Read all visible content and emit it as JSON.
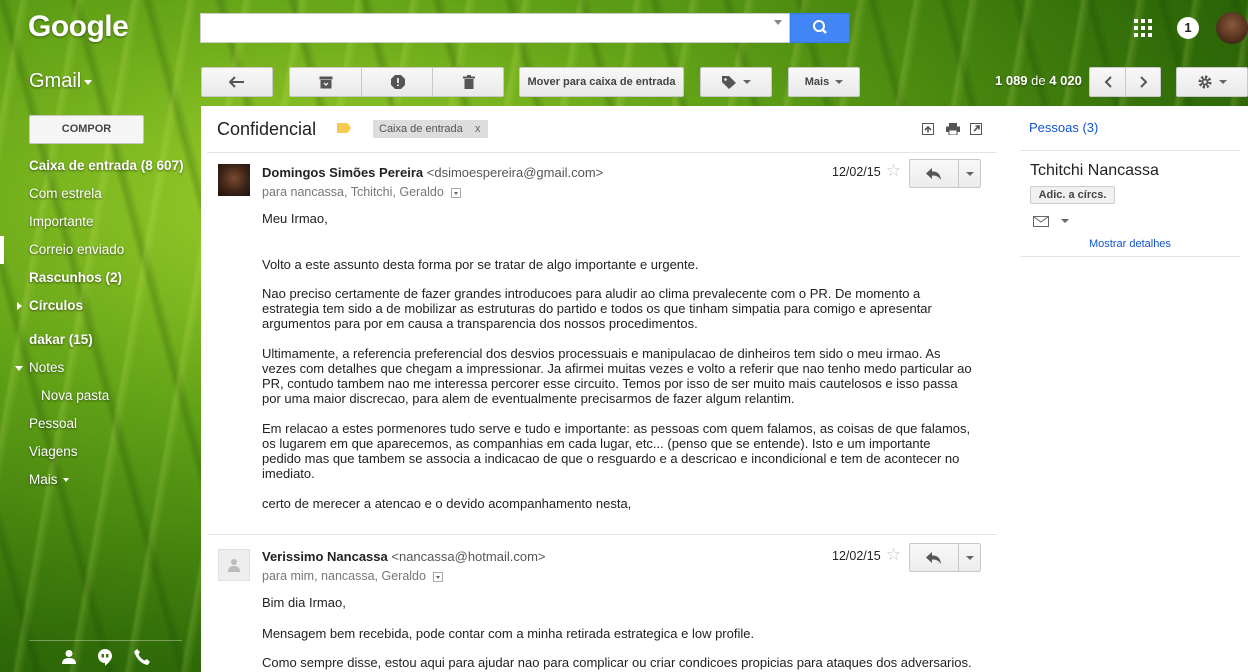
{
  "header": {
    "logo": "Google",
    "search_value": "",
    "notification_count": "1",
    "app_label": "Gmail"
  },
  "toolbar": {
    "move_to_inbox": "Mover para caixa de entrada",
    "more": "Mais",
    "range_start": "1 089",
    "range_of": "de",
    "range_total": "4 020"
  },
  "sidebar": {
    "compose": "COMPOR",
    "items": [
      {
        "label": "Caixa de entrada (8 607)",
        "bold": true
      },
      {
        "label": "Com estrela",
        "bold": false
      },
      {
        "label": "Importante",
        "bold": false
      },
      {
        "label": "Correio enviado",
        "bold": false
      },
      {
        "label": "Rascunhos (2)",
        "bold": true
      },
      {
        "label": "Círculos",
        "bold": true
      },
      {
        "label": "dakar (15)",
        "bold": true
      },
      {
        "label": "Notes",
        "bold": false
      },
      {
        "label": "Nova pasta",
        "bold": false
      },
      {
        "label": "Pessoal",
        "bold": false
      },
      {
        "label": "Viagens",
        "bold": false
      },
      {
        "label": "Mais",
        "bold": false
      }
    ]
  },
  "thread": {
    "subject": "Confidencial",
    "label_chip": "Caixa de entrada",
    "label_chip_remove": "x",
    "messages": [
      {
        "sender": "Domingos Simões Pereira",
        "email": "<dsimoespereira@gmail.com>",
        "recipients": "para nancassa, Tchitchi, Geraldo",
        "date": "12/02/15",
        "body": [
          "Meu Irmao,",
          "Volto a este assunto desta forma por se tratar de algo importante e urgente.",
          "Nao preciso certamente de fazer grandes introducoes para aludir ao clima prevalecente com o PR. De momento a estrategia tem sido a de mobilizar as estruturas do partido e todos os que tinham simpatia para comigo e apresentar argumentos para por em causa a transparencia dos nossos procedimentos.",
          "Ultimamente, a referencia preferencial dos desvios processuais e manipulacao de dinheiros tem sido o meu irmao. As vezes com detalhes que chegam a impressionar. Ja afirmei muitas vezes e volto a referir que nao tenho medo particular ao PR, contudo tambem nao me interessa percorer esse circuito. Temos por isso de ser muito mais cautelosos e isso passa por uma maior discrecao, para alem de eventualmente precisarmos de fazer algum relantim.",
          "Em relacao a estes pormenores tudo serve e tudo e importante: as pessoas com quem falamos, as coisas de que falamos, os lugarem em que aparecemos, as companhias em cada lugar, etc... (penso que se entende). Isto e um importante pedido mas que tambem se associa a indicacao de que o resguardo e a descricao e incondicional e tem de acontecer no imediato.",
          "certo de merecer a atencao e o devido acompanhamento nesta,"
        ]
      },
      {
        "sender": "Verissimo Nancassa",
        "email": "<nancassa@hotmail.com>",
        "recipients": "para mim, nancassa, Geraldo",
        "date": "12/02/15",
        "body": [
          "Bim dia Irmao,",
          "Mensagem bem recebida, pode contar com a minha retirada estrategica e low profile.",
          "Como sempre disse, estou aqui para ajudar nao para complicar ou criar condicoes propicias para ataques dos adversarios."
        ]
      }
    ]
  },
  "people_panel": {
    "title": "Pessoas (3)",
    "contact_name": "Tchitchi Nancassa",
    "add_button": "Adic. a círcs.",
    "show_details": "Mostrar detalhes"
  },
  "colors": {
    "search_blue": "#4285f4",
    "link_blue": "#1155cc",
    "label_yellow": "#f7cb4d"
  }
}
